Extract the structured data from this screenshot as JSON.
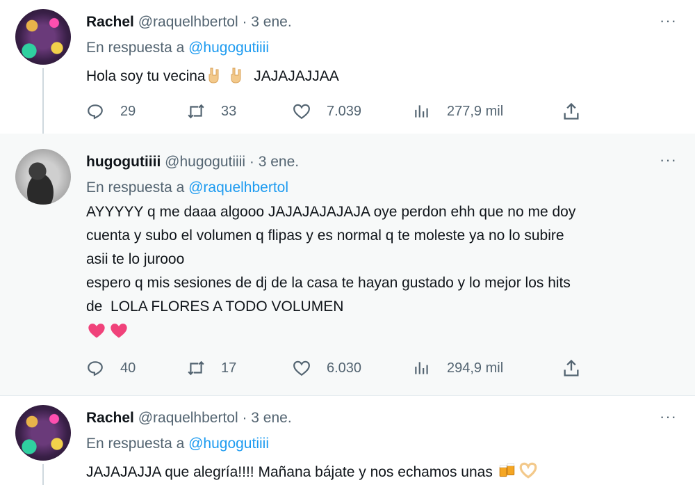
{
  "tweets": [
    {
      "author": {
        "name": "Rachel",
        "handle": "@raquelhbertol",
        "date": "3 ene."
      },
      "reply_prefix": "En respuesta a ",
      "reply_to": "@hugogutiiii",
      "text_before": "Hola soy tu vecina",
      "text_after": "  JAJAJAJJAA",
      "stats": {
        "replies": "29",
        "retweets": "33",
        "likes": "7.039",
        "views": "277,9 mil"
      }
    },
    {
      "author": {
        "name": "hugogutiiii",
        "handle": "@hugogutiiii",
        "date": "3 ene."
      },
      "reply_prefix": "En respuesta a ",
      "reply_to": "@raquelhbertol",
      "text": "AYYYYY q me daaa algooo JAJAJAJAJAJA oye perdon ehh que no me doy\ncuenta y subo el volumen q flipas y es normal q te moleste ya no lo subire\nasii te lo jurooo\nespero q mis sesiones de dj de la casa te hayan gustado y lo mejor los hits\nde  LOLA FLORES A TODO VOLUMEN",
      "stats": {
        "replies": "40",
        "retweets": "17",
        "likes": "6.030",
        "views": "294,9 mil"
      }
    },
    {
      "author": {
        "name": "Rachel",
        "handle": "@raquelhbertol",
        "date": "3 ene."
      },
      "reply_prefix": "En respuesta a ",
      "reply_to": "@hugogutiiii",
      "text": "JAJAJAJJA que alegría!!!! Mañana bájate y nos echamos unas "
    }
  ],
  "separator": " · ",
  "more_icon": "more-horizontal-icon",
  "emoji_colors": {
    "hand": "#f3c98b",
    "heart": "#f0427a",
    "beer": "#f5a623"
  }
}
